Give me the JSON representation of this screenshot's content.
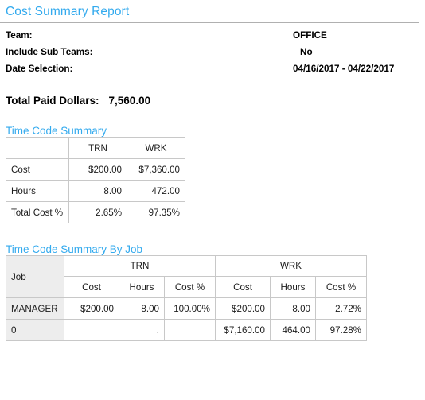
{
  "report": {
    "title": "Cost Summary Report"
  },
  "params": [
    {
      "label": "Team:",
      "value": "OFFICE",
      "indent": false
    },
    {
      "label": "Include Sub Teams:",
      "value": "No",
      "indent": true
    },
    {
      "label": "Date Selection:",
      "value": "04/16/2017 - 04/22/2017",
      "indent": false
    }
  ],
  "total_paid": {
    "label": "Total Paid Dollars:",
    "value": "7,560.00"
  },
  "time_code_summary": {
    "heading": "Time Code Summary",
    "columns": [
      "TRN",
      "WRK"
    ],
    "rows": [
      {
        "label": "Cost",
        "values": [
          "$200.00",
          "$7,360.00"
        ]
      },
      {
        "label": "Hours",
        "values": [
          "8.00",
          "472.00"
        ]
      },
      {
        "label": "Total Cost %",
        "values": [
          "2.65%",
          "97.35%"
        ]
      }
    ]
  },
  "time_code_summary_by_job": {
    "heading": "Time Code Summary By Job",
    "job_header": "Job",
    "groups": [
      "TRN",
      "WRK"
    ],
    "subcolumns": [
      "Cost",
      "Hours",
      "Cost %"
    ],
    "rows": [
      {
        "job": "MANAGER",
        "trn": {
          "cost": "$200.00",
          "hours": "8.00",
          "cost_pct": "100.00%"
        },
        "wrk": {
          "cost": "$200.00",
          "hours": "8.00",
          "cost_pct": "2.72%"
        }
      },
      {
        "job": "0",
        "trn": {
          "cost": "",
          "hours": ".",
          "cost_pct": ""
        },
        "wrk": {
          "cost": "$7,160.00",
          "hours": "464.00",
          "cost_pct": "97.28%"
        }
      }
    ]
  },
  "colors": {
    "accent": "#33aaee",
    "header_fill": "#ededed",
    "border": "#c8c8c8",
    "rule": "#b0b0b0"
  }
}
